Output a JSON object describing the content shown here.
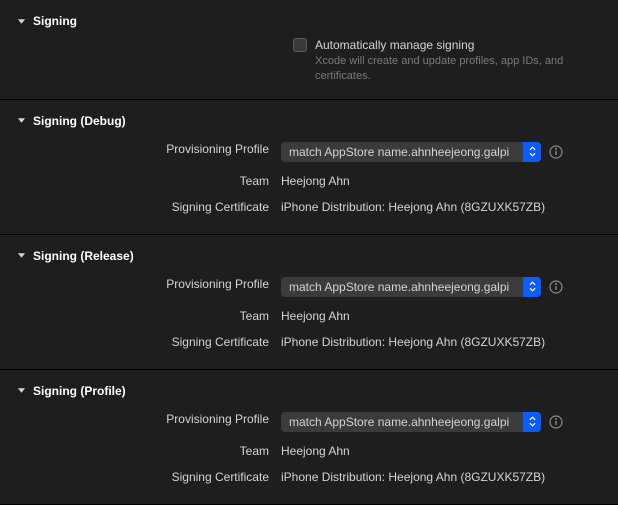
{
  "sections": {
    "signing": {
      "title": "Signing",
      "checkbox_label": "Automatically manage signing",
      "hint": "Xcode will create and update profiles, app IDs, and certificates."
    },
    "debug": {
      "title": "Signing (Debug)",
      "profile_label": "Provisioning Profile",
      "profile_value": "match AppStore name.ahnheejeong.galpi",
      "team_label": "Team",
      "team_value": "Heejong Ahn",
      "cert_label": "Signing Certificate",
      "cert_value": "iPhone Distribution: Heejong Ahn (8GZUXK57ZB)"
    },
    "release": {
      "title": "Signing (Release)",
      "profile_label": "Provisioning Profile",
      "profile_value": "match AppStore name.ahnheejeong.galpi",
      "team_label": "Team",
      "team_value": "Heejong Ahn",
      "cert_label": "Signing Certificate",
      "cert_value": "iPhone Distribution: Heejong Ahn (8GZUXK57ZB)"
    },
    "profile": {
      "title": "Signing (Profile)",
      "profile_label": "Provisioning Profile",
      "profile_value": "match AppStore name.ahnheejeong.galpi",
      "team_label": "Team",
      "team_value": "Heejong Ahn",
      "cert_label": "Signing Certificate",
      "cert_value": "iPhone Distribution: Heejong Ahn (8GZUXK57ZB)"
    }
  }
}
